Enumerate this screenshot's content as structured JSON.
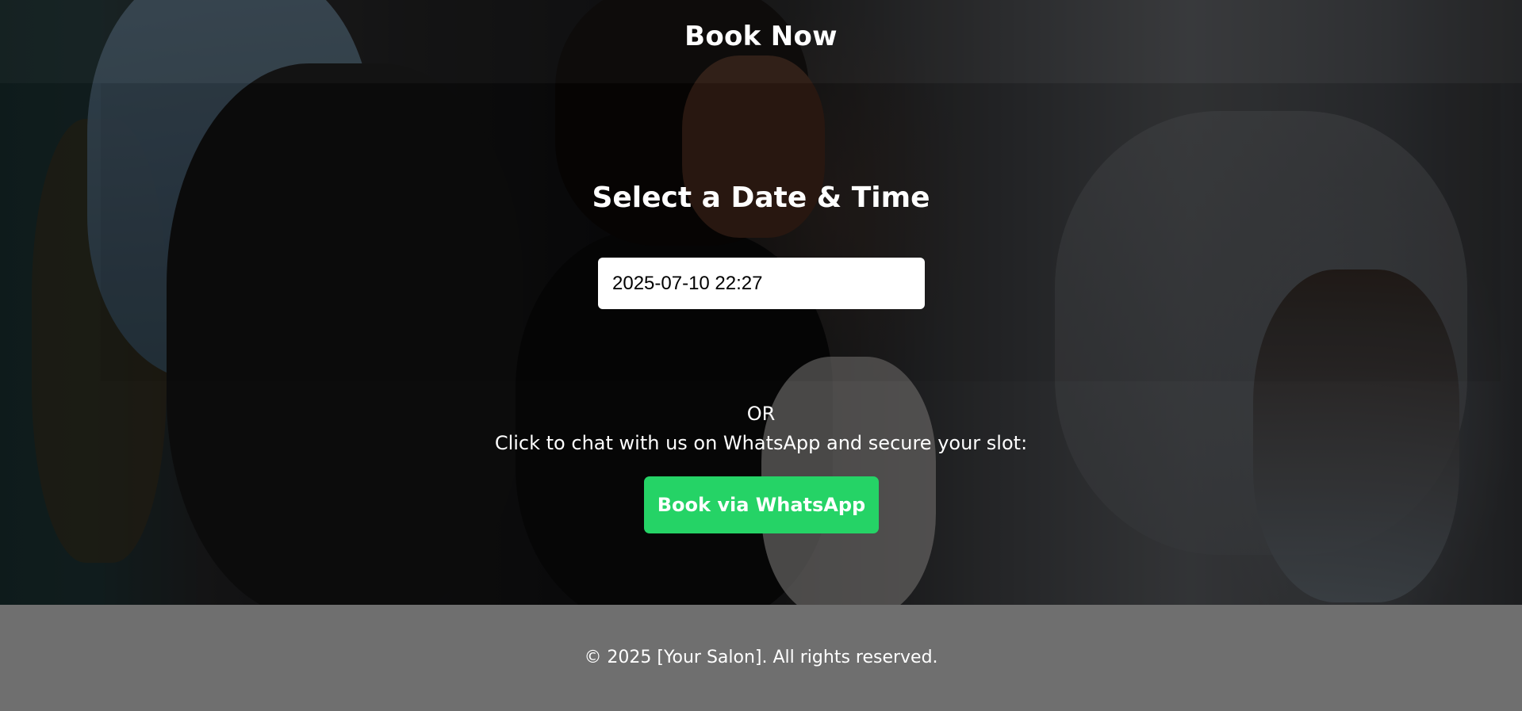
{
  "header": {
    "title": "Book Now"
  },
  "booking": {
    "section_title": "Select a Date & Time",
    "datetime_value": "2025-07-10 22:27",
    "or_label": "OR",
    "whatsapp_prompt": "Click to chat with us on WhatsApp and secure your slot:",
    "whatsapp_button_label": "Book via WhatsApp",
    "whatsapp_button_color": "#25d366"
  },
  "footer": {
    "copyright": "© 2025 [Your Salon]. All rights reserved.",
    "background_color": "#6f6f6f"
  }
}
